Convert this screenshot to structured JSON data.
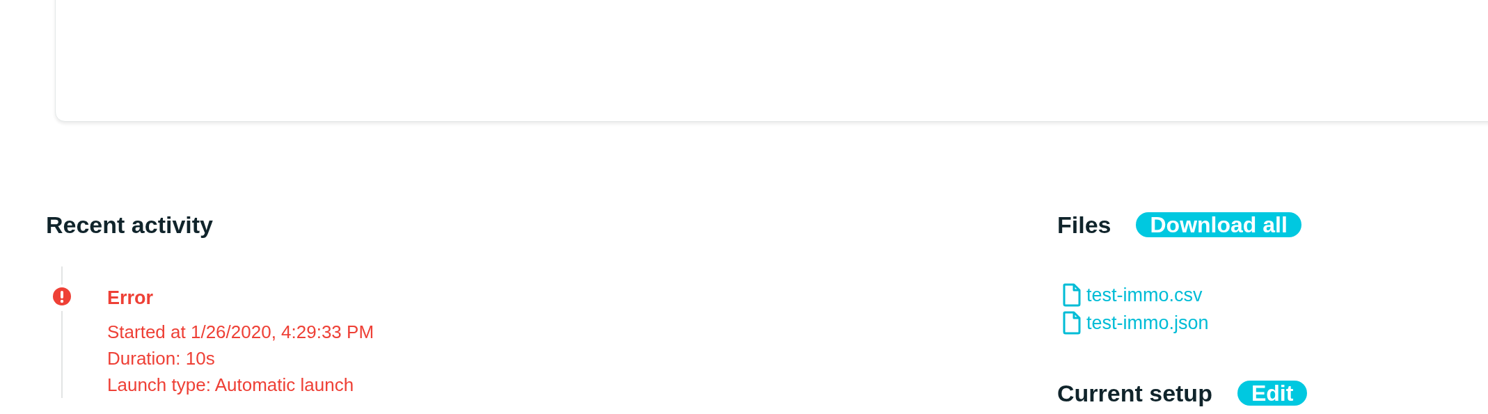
{
  "activity": {
    "title": "Recent activity",
    "events": [
      {
        "kind": "error",
        "title": "Error",
        "lines": [
          "Started at 1/26/2020, 4:29:33 PM",
          "Duration: 10s",
          "Launch type: Automatic launch"
        ]
      }
    ]
  },
  "files": {
    "title": "Files",
    "action": "Download all",
    "items": [
      "test-immo.csv",
      "test-immo.json"
    ]
  },
  "setup": {
    "title": "Current setup",
    "action": "Edit"
  }
}
